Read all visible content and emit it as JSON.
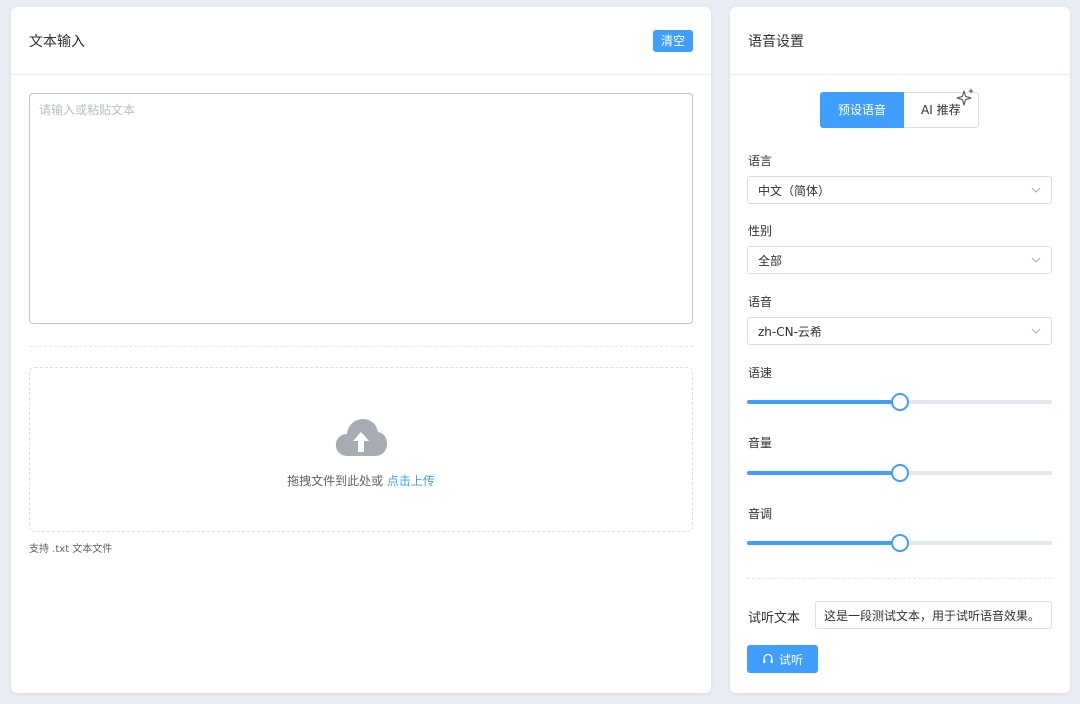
{
  "left": {
    "title": "文本输入",
    "clear_label": "清空",
    "textarea_placeholder": "请输入或粘贴文本",
    "textarea_value": "",
    "upload": {
      "icon": "cloud-upload-icon",
      "prompt": "拖拽文件到此处或 ",
      "link": "点击上传",
      "tip": "支持 .txt 文本文件"
    }
  },
  "right": {
    "title": "语音设置",
    "tabs": [
      {
        "label": "预设语音",
        "active": true
      },
      {
        "label": "AI 推荐",
        "active": false,
        "icon": "sparkle-icon"
      }
    ],
    "language": {
      "label": "语言",
      "value": "中文（简体）"
    },
    "gender": {
      "label": "性别",
      "value": "全部"
    },
    "voice": {
      "label": "语音",
      "value": "zh-CN-云希"
    },
    "rate": {
      "label": "语速",
      "level": 0.5
    },
    "volume": {
      "label": "音量",
      "level": 0.5
    },
    "pitch": {
      "label": "音调",
      "level": 0.5
    },
    "preview": {
      "label": "试听文本",
      "value": "这是一段测试文本，用于试听语音效果。",
      "button": "试听",
      "button_icon": "headset-icon"
    }
  },
  "colors": {
    "accent": "#409eff",
    "background": "#e9edf3"
  }
}
